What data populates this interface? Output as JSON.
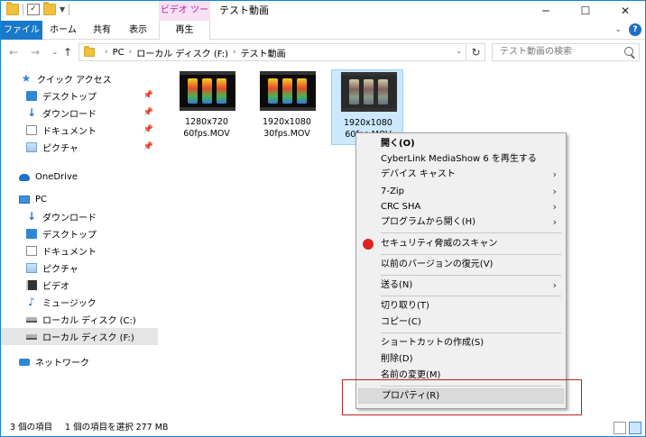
{
  "window": {
    "title": "テスト動画",
    "context_tab_header": "ビデオ ツール"
  },
  "ribbon": {
    "tabs": [
      "ファイル",
      "ホーム",
      "共有",
      "表示",
      "再生"
    ]
  },
  "address": {
    "crumbs": [
      "PC",
      "ローカル ディスク (F:)",
      "テスト動画"
    ],
    "search_placeholder": "テスト動画の検索"
  },
  "sidebar": {
    "items": [
      {
        "label": "クイック アクセス",
        "icon": "star-icon",
        "pinned": false
      },
      {
        "label": "デスクトップ",
        "icon": "desktop-icon",
        "pinned": true
      },
      {
        "label": "ダウンロード",
        "icon": "download-icon",
        "pinned": true
      },
      {
        "label": "ドキュメント",
        "icon": "document-icon",
        "pinned": true
      },
      {
        "label": "ピクチャ",
        "icon": "picture-icon",
        "pinned": true
      },
      {
        "label": "OneDrive",
        "icon": "cloud-icon",
        "pinned": false
      },
      {
        "label": "PC",
        "icon": "pc-icon",
        "pinned": false
      },
      {
        "label": "ダウンロード",
        "icon": "download-icon",
        "pinned": false
      },
      {
        "label": "デスクトップ",
        "icon": "desktop-icon",
        "pinned": false
      },
      {
        "label": "ドキュメント",
        "icon": "document-icon",
        "pinned": false
      },
      {
        "label": "ピクチャ",
        "icon": "picture-icon",
        "pinned": false
      },
      {
        "label": "ビデオ",
        "icon": "video-icon",
        "pinned": false
      },
      {
        "label": "ミュージック",
        "icon": "music-icon",
        "pinned": false
      },
      {
        "label": "ローカル ディスク (C:)",
        "icon": "drive-icon",
        "pinned": false
      },
      {
        "label": "ローカル ディスク (F:)",
        "icon": "drive-icon",
        "pinned": false,
        "selected": true
      },
      {
        "label": "ネットワーク",
        "icon": "network-icon",
        "pinned": false
      }
    ]
  },
  "files": [
    {
      "line1": "1280x720",
      "line2": "60fps.MOV",
      "selected": false
    },
    {
      "line1": "1920x1080",
      "line2": "30fps.MOV",
      "selected": false
    },
    {
      "line1": "1920x1080",
      "line2": "60fps.MOV",
      "selected": true
    }
  ],
  "context_menu": {
    "items": [
      {
        "label": "開く(O)",
        "bold": true
      },
      {
        "label": "CyberLink MediaShow 6 を再生する"
      },
      {
        "label": "デバイス キャスト",
        "submenu": true
      },
      {
        "label": "7-Zip",
        "submenu": true
      },
      {
        "label": "CRC SHA",
        "submenu": true
      },
      {
        "label": "プログラムから開く(H)",
        "submenu": true
      },
      {
        "label": "セキュリティ脅威のスキャン",
        "icon": "security-scan-icon"
      },
      {
        "label": "以前のバージョンの復元(V)"
      },
      {
        "label": "送る(N)",
        "submenu": true
      },
      {
        "label": "切り取り(T)"
      },
      {
        "label": "コピー(C)"
      },
      {
        "label": "ショートカットの作成(S)"
      },
      {
        "label": "削除(D)"
      },
      {
        "label": "名前の変更(M)"
      },
      {
        "label": "プロパティ(R)",
        "highlighted": true
      }
    ]
  },
  "statusbar": {
    "count": "3 個の項目",
    "selection": "1 個の項目を選択  277 MB"
  },
  "colors": {
    "accent": "#1979ca",
    "context_tab": "#b0219a",
    "highlight_box": "#c02020"
  }
}
